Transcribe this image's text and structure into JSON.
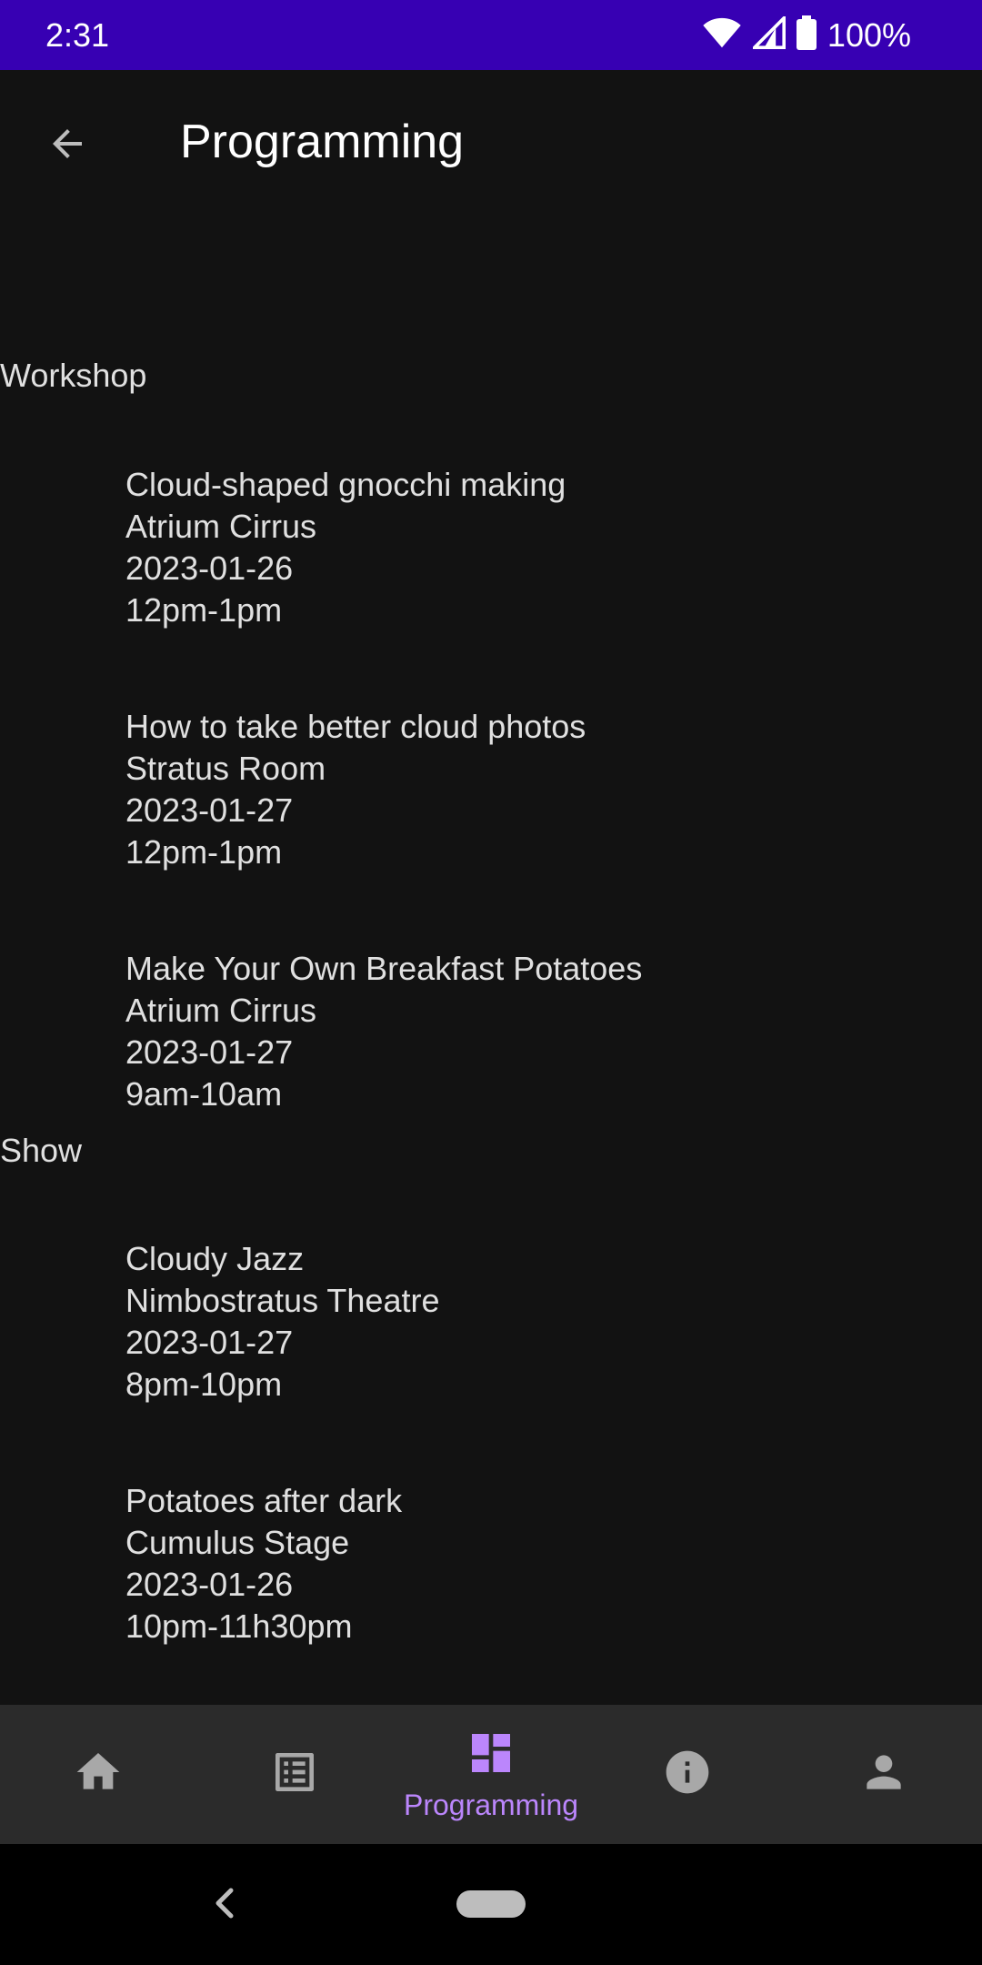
{
  "status_bar": {
    "time": "2:31",
    "battery": "100%",
    "color": "#3700b3"
  },
  "app_bar": {
    "title": "Programming",
    "back_icon": "arrow-back-icon"
  },
  "sections": [
    {
      "title": "Workshop",
      "events": [
        {
          "name": "Cloud-shaped gnocchi making",
          "location": "Atrium Cirrus",
          "date": "2023-01-26",
          "time": "12pm-1pm"
        },
        {
          "name": "How to take better cloud photos",
          "location": "Stratus Room",
          "date": "2023-01-27",
          "time": "12pm-1pm"
        },
        {
          "name": "Make Your Own Breakfast Potatoes",
          "location": "Atrium Cirrus",
          "date": "2023-01-27",
          "time": "9am-10am"
        }
      ]
    },
    {
      "title": "Show",
      "events": [
        {
          "name": "Cloudy Jazz",
          "location": "Nimbostratus Theatre",
          "date": "2023-01-27",
          "time": "8pm-10pm"
        },
        {
          "name": "Potatoes after dark",
          "location": "Cumulus Stage",
          "date": "2023-01-26",
          "time": "10pm-11h30pm"
        }
      ]
    }
  ],
  "bottom_nav": {
    "items": [
      {
        "icon": "home-icon",
        "label": ""
      },
      {
        "icon": "list-icon",
        "label": ""
      },
      {
        "icon": "dashboard-icon",
        "label": "Programming",
        "selected": true
      },
      {
        "icon": "info-icon",
        "label": ""
      },
      {
        "icon": "person-icon",
        "label": ""
      }
    ],
    "selected_color": "#bb86fc",
    "icon_color": "#a8a8a8"
  }
}
